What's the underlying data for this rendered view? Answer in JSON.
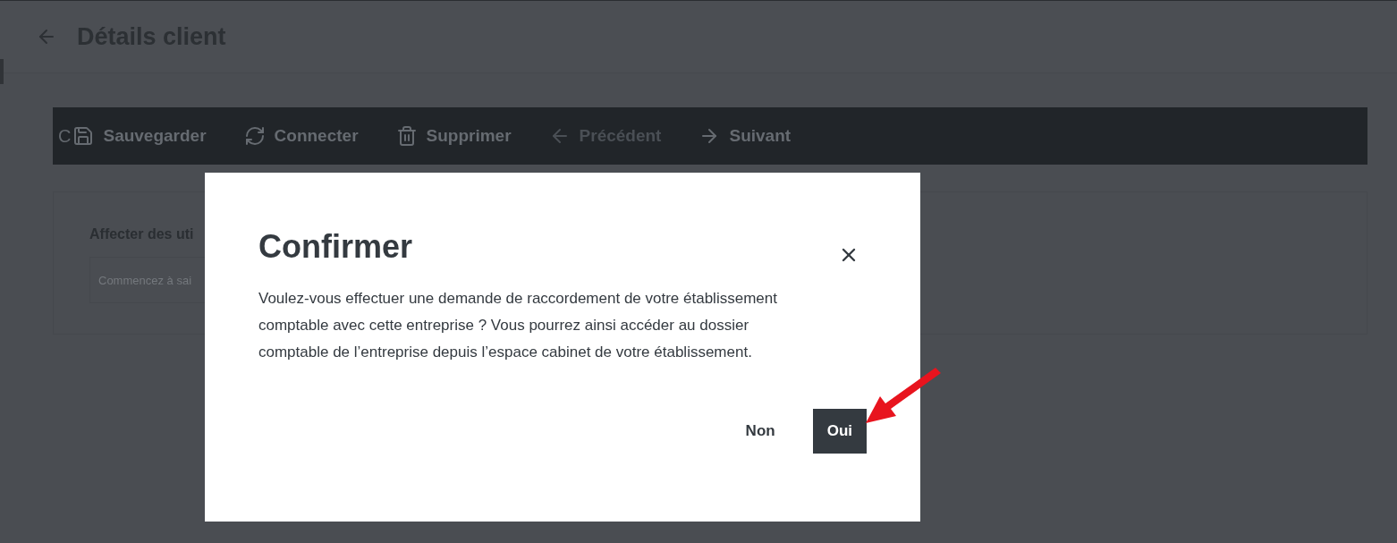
{
  "header": {
    "title": "Détails client"
  },
  "toolbar": {
    "leading_text": "C",
    "items": [
      {
        "kind": "save",
        "label": "Sauvegarder",
        "disabled": false
      },
      {
        "kind": "connect",
        "label": "Connecter",
        "disabled": false
      },
      {
        "kind": "delete",
        "label": "Supprimer",
        "disabled": false
      },
      {
        "kind": "previous",
        "label": "Précédent",
        "disabled": true
      },
      {
        "kind": "next",
        "label": "Suivant",
        "disabled": false
      }
    ]
  },
  "card": {
    "title": "Affecter des uti",
    "field": {
      "placeholder": "Commencez à sai"
    }
  },
  "dialog": {
    "title": "Confirmer",
    "message": "Voulez-vous effectuer une demande de raccordement de votre établissement comptable avec cette entreprise ? Vous pourrez ainsi accéder au dossier comptable de l’entreprise depuis l’espace cabinet de votre établissement.",
    "buttons": [
      {
        "kind": "secondary",
        "label": "Non"
      },
      {
        "kind": "primary",
        "label": "Oui"
      }
    ]
  }
}
